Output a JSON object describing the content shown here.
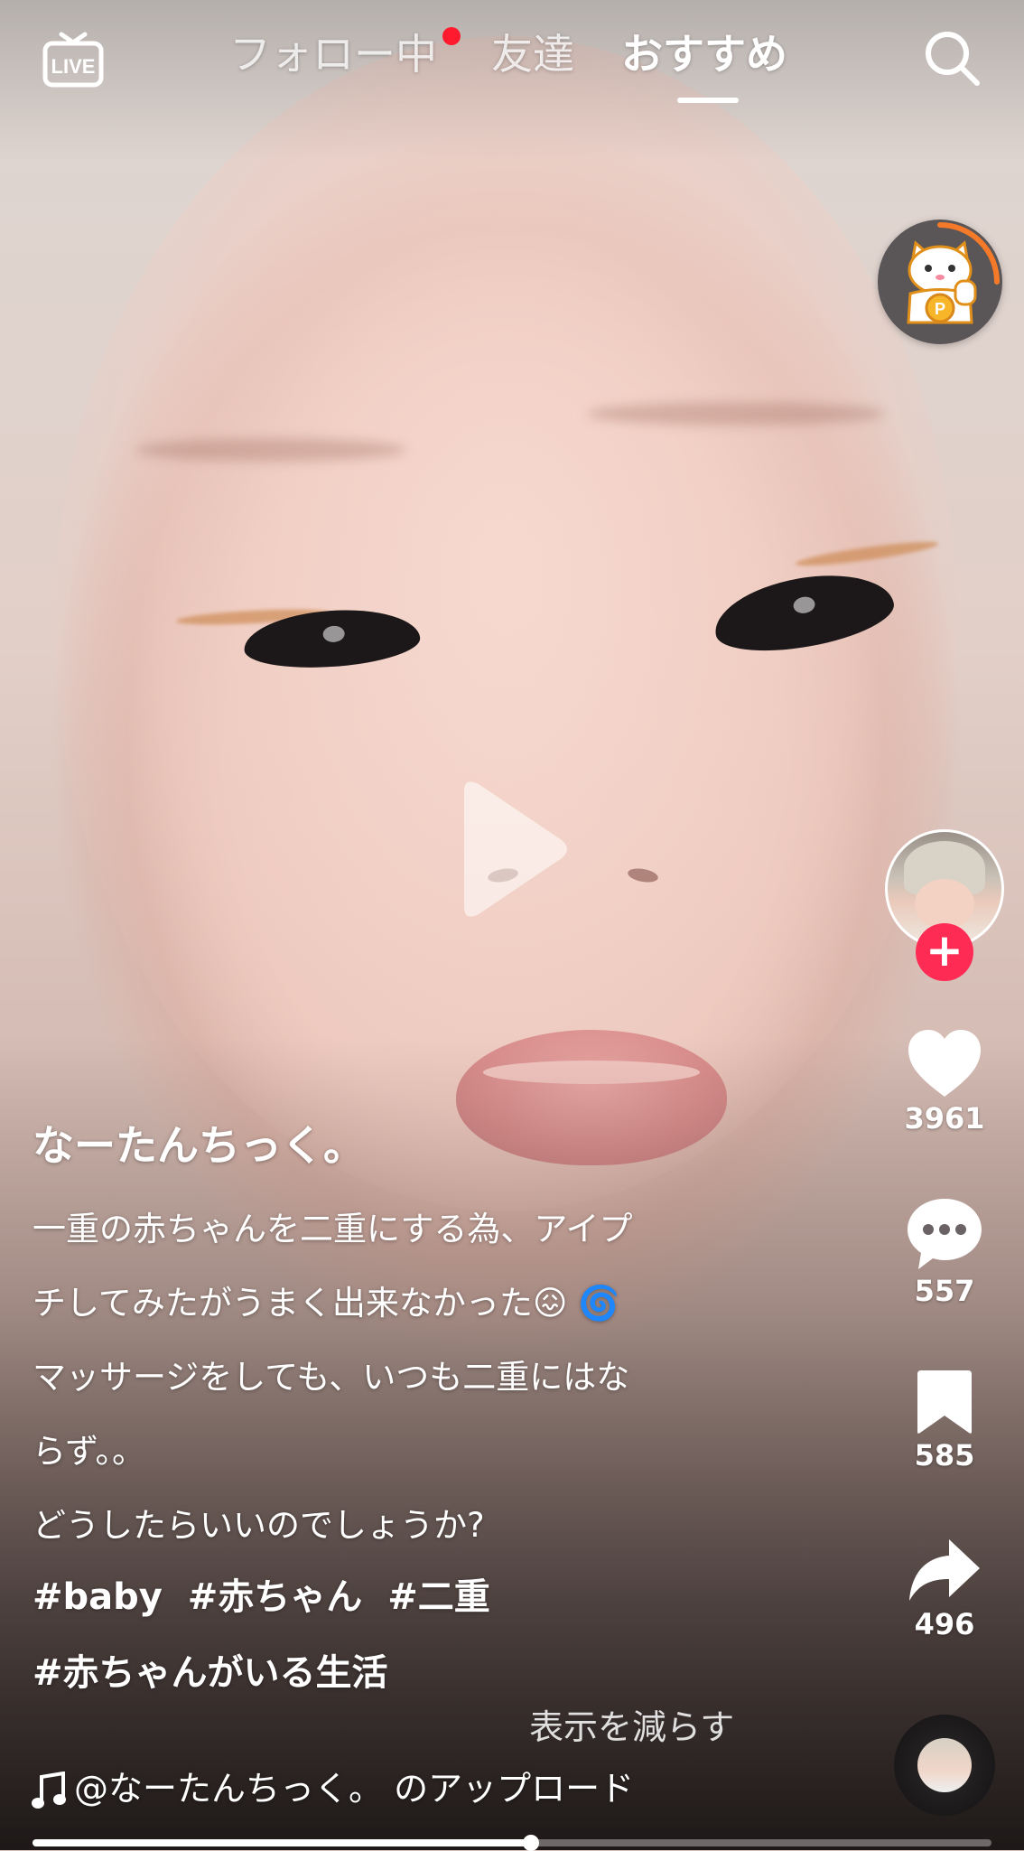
{
  "topbar": {
    "live_label": "LIVE",
    "tabs": [
      {
        "label": "フォロー中",
        "active": false,
        "has_notification": true
      },
      {
        "label": "友達",
        "active": false
      },
      {
        "label": "おすすめ",
        "active": true
      }
    ]
  },
  "reward": {
    "coin_letter": "P"
  },
  "creator": {
    "username": "なーたんちっく。"
  },
  "caption": {
    "lines": [
      "一重の赤ちゃんを二重にする為、アイプ",
      "チしてみたがうまく出来なかった😖 🌀",
      "マッサージをしても、いつも二重にはな",
      "らず。。",
      "どうしたらいいのでしょうか?"
    ],
    "hashtags": [
      [
        "#baby",
        "#赤ちゃん",
        "#二重"
      ],
      [
        "#赤ちゃんがいる生活"
      ]
    ],
    "show_less": "表示を減らす"
  },
  "actions": {
    "likes": "3961",
    "comments": "557",
    "saves": "585",
    "shares": "496"
  },
  "music": {
    "text": "@なーたんちっく。 のアップロード"
  },
  "progress": {
    "fraction": 0.52
  },
  "colors": {
    "accent": "#fe2c55",
    "notification": "#ff1a2e"
  }
}
